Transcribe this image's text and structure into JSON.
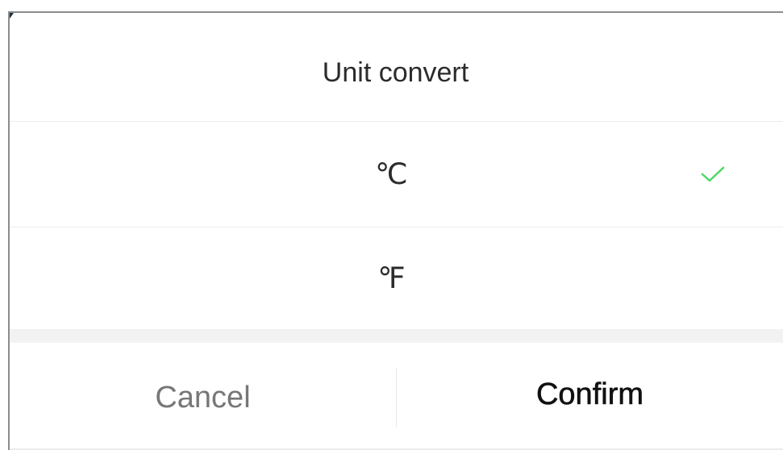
{
  "dialog": {
    "title": "Unit convert",
    "options": [
      {
        "label": "℃",
        "selected": true
      },
      {
        "label": "℉",
        "selected": false
      }
    ],
    "buttons": {
      "cancel_label": "Cancel",
      "confirm_label": "Confirm"
    }
  },
  "colors": {
    "check": "#4cd964",
    "divider": "#ececec",
    "band": "#f2f2f2",
    "text_primary": "#2b2b2b",
    "text_muted": "#777777"
  },
  "icons": {
    "selected_marker": "checkmark-icon"
  }
}
